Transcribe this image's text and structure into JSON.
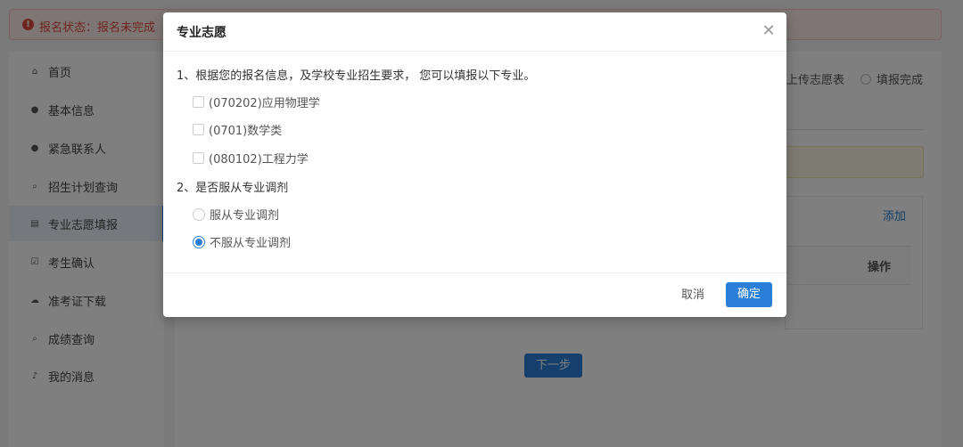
{
  "status": {
    "text": "报名状态：报名未完成",
    "icon": "alert-circle-icon"
  },
  "sidebar": {
    "items": [
      {
        "label": "首页",
        "icon": "home-icon",
        "glyph": "⌂",
        "active": false
      },
      {
        "label": "基本信息",
        "icon": "user-icon",
        "glyph": "●",
        "active": false
      },
      {
        "label": "紧急联系人",
        "icon": "user-icon",
        "glyph": "●",
        "active": false
      },
      {
        "label": "招生计划查询",
        "icon": "search-icon",
        "glyph": "⌕",
        "active": false
      },
      {
        "label": "专业志愿填报",
        "icon": "document-icon",
        "glyph": "▤",
        "active": true
      },
      {
        "label": "考生确认",
        "icon": "check-square-icon",
        "glyph": "☑",
        "active": false
      },
      {
        "label": "准考证下载",
        "icon": "cloud-download-icon",
        "glyph": "☁",
        "active": false
      },
      {
        "label": "成绩查询",
        "icon": "search-icon",
        "glyph": "⌕",
        "active": false
      },
      {
        "label": "我的消息",
        "icon": "bell-icon",
        "glyph": "♪",
        "active": false
      }
    ]
  },
  "steps": {
    "upload": "上传志愿表",
    "complete": "填报完成"
  },
  "table": {
    "add_label": "添加",
    "op_header": "操作"
  },
  "next_label": "下一步",
  "modal": {
    "title": "专业志愿",
    "close_icon": "close-icon",
    "q1": "1、根据您的报名信息，及学校专业招生要求， 您可以填报以下专业。",
    "majors": [
      {
        "label": "(070202)应用物理学",
        "checked": false
      },
      {
        "label": "(0701)数学类",
        "checked": false
      },
      {
        "label": "(080102)工程力学",
        "checked": false
      }
    ],
    "q2": "2、是否服从专业调剂",
    "adjust_options": [
      {
        "label": "服从专业调剂",
        "checked": false
      },
      {
        "label": "不服从专业调剂",
        "checked": true
      }
    ],
    "cancel_label": "取消",
    "confirm_label": "确定"
  },
  "colors": {
    "primary": "#2a7fd9",
    "danger": "#e0483d"
  }
}
